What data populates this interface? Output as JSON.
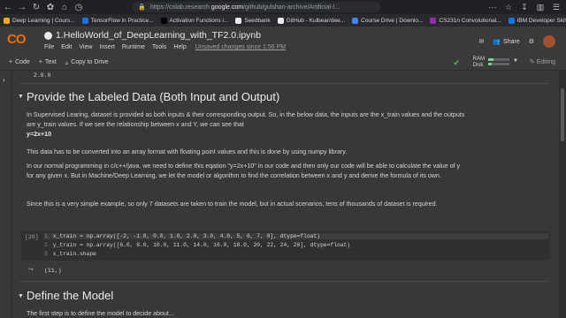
{
  "browser": {
    "url_prefix": "https://colab.research.",
    "url_host": "google.com",
    "url_rest": "/github/gulshan-archive/Artificial-I..."
  },
  "bookmarks": [
    {
      "label": "Deep Learning | Cours...",
      "color": "#f9ab00"
    },
    {
      "label": "TensorFlow in Practice...",
      "color": "#1a73e8"
    },
    {
      "label": "Activation Functions i...",
      "color": "#000000"
    },
    {
      "label": "Seedbank",
      "color": "#e8eaed"
    },
    {
      "label": "GitHub - Kulbear/dee...",
      "color": "#e8eaed"
    },
    {
      "label": "Course Drive | Downlo...",
      "color": "#4285f4"
    },
    {
      "label": "CS231n Convolutional...",
      "color": "#9c27b0"
    },
    {
      "label": "IBM Developer Skills N...",
      "color": "#1a73e8"
    }
  ],
  "colab": {
    "logo": "CO",
    "notebook_title": "1.HelloWorld_of_DeepLearning_with_TF2.0.ipynb",
    "menu": [
      "File",
      "Edit",
      "View",
      "Insert",
      "Runtime",
      "Tools",
      "Help"
    ],
    "unsaved": "Unsaved changes since 1:56 PM",
    "share_label": "Share"
  },
  "toolbar": {
    "code": "Code",
    "text": "Text",
    "copy_drive": "Copy to Drive",
    "ram": "RAM",
    "disk": "Disk",
    "editing": "Editing",
    "ram_usage": 0.25,
    "disk_usage": 0.15
  },
  "notebook": {
    "prev_output": "2.0.0",
    "section1_title": "Provide the Labeled Data (Both Input and Output)",
    "p1": "In Supervised Learing, dataset is provided as both inputs & their corresponding output. So, in the below data, the inputs are the x_train values and the outputs are y_train values. If we see the relationship between x and Y, we can see that",
    "formula": "y=2x+10",
    "p2": "This data has to be converted into an array format with floating point values and this is done by using numpy library.",
    "p3": "In our normal programming in c/c++/java, we need to define this eqation \"y=2x+10\" in our code and then only our code will be able to calculate the value of y for any given x. But in Machine/Deep Learning, we let the model or algorithm to find the correlation between x and y and derive the formula of its own.",
    "p4": "Since this is a very simple example, so only 7 datasets are taken to train the model, but in actual scenarios, tens of thousands of dataset is required.",
    "exec_count": "[20]",
    "code_lines": [
      "x_train = np.array([-2, -1.0, 0.0, 1.0, 2.0, 3.0, 4.0, 5, 6, 7, 8], dtype=float)",
      "y_train = np.array([6.0, 8.0, 10.0, 11.0, 14.0, 16.0, 18.0, 20, 22, 24, 26], dtype=float)",
      "x_train.shape"
    ],
    "line_numbers": [
      "1",
      "2",
      "3"
    ],
    "cell_output": "(11,)",
    "section2_title": "Define the Model",
    "p5": "The first step is to define the model to decide about..."
  }
}
